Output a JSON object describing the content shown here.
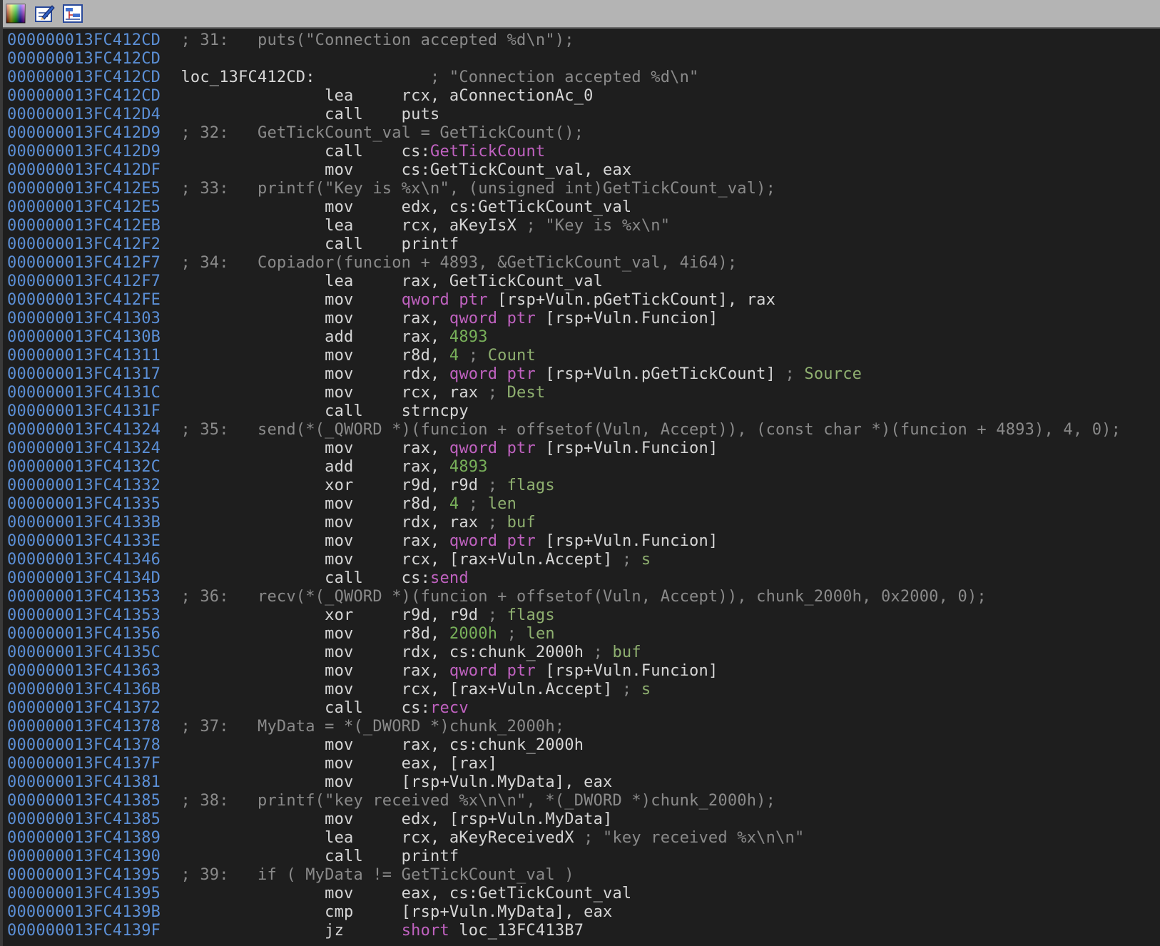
{
  "toolbar": {
    "buttons": [
      {
        "name": "color-palette-icon"
      },
      {
        "name": "edit-pencil-icon"
      },
      {
        "name": "graph-view-icon"
      }
    ]
  },
  "colors": {
    "address": "#5b8fd6",
    "text": "#d6d6d6",
    "comment": "#8a8a8a",
    "number": "#78b05a",
    "keyword": "#c062c0",
    "background": "#1e1e1e"
  },
  "lines": [
    {
      "addr": "000000013FC412CD",
      "parts": [
        {
          "t": " ; 31:   puts(\"Connection accepted %d\\n\");",
          "c": "comment"
        }
      ]
    },
    {
      "addr": "000000013FC412CD",
      "parts": []
    },
    {
      "addr": "000000013FC412CD",
      "parts": [
        {
          "t": " loc_13FC412CD:",
          "c": "default"
        },
        {
          "t": "            ; \"Connection accepted %d\\n\"",
          "c": "comment"
        }
      ]
    },
    {
      "addr": "000000013FC412CD",
      "parts": [
        {
          "t": "                lea     rcx, aConnectionAc_0",
          "c": "default"
        }
      ]
    },
    {
      "addr": "000000013FC412D4",
      "parts": [
        {
          "t": "                call    puts",
          "c": "default"
        }
      ]
    },
    {
      "addr": "000000013FC412D9",
      "parts": [
        {
          "t": " ; 32:   GetTickCount_val = GetTickCount();",
          "c": "comment"
        }
      ]
    },
    {
      "addr": "000000013FC412D9",
      "parts": [
        {
          "t": "                call    cs:",
          "c": "default"
        },
        {
          "t": "GetTickCount",
          "c": "kw"
        }
      ]
    },
    {
      "addr": "000000013FC412DF",
      "parts": [
        {
          "t": "                mov     cs:GetTickCount_val, eax",
          "c": "default"
        }
      ]
    },
    {
      "addr": "000000013FC412E5",
      "parts": [
        {
          "t": " ; 33:   printf(\"Key is %x\\n\", (unsigned int)GetTickCount_val);",
          "c": "comment"
        }
      ]
    },
    {
      "addr": "000000013FC412E5",
      "parts": [
        {
          "t": "                mov     edx, cs:GetTickCount_val",
          "c": "default"
        }
      ]
    },
    {
      "addr": "000000013FC412EB",
      "parts": [
        {
          "t": "                lea     rcx, aKeyIsX",
          "c": "default"
        },
        {
          "t": " ; \"Key is %x\\n\"",
          "c": "comment"
        }
      ]
    },
    {
      "addr": "000000013FC412F2",
      "parts": [
        {
          "t": "                call    printf",
          "c": "default"
        }
      ]
    },
    {
      "addr": "000000013FC412F7",
      "parts": [
        {
          "t": " ; 34:   Copiador(funcion + 4893, &GetTickCount_val, 4i64);",
          "c": "comment"
        }
      ]
    },
    {
      "addr": "000000013FC412F7",
      "parts": [
        {
          "t": "                lea     rax, GetTickCount_val",
          "c": "default"
        }
      ]
    },
    {
      "addr": "000000013FC412FE",
      "parts": [
        {
          "t": "                mov     ",
          "c": "default"
        },
        {
          "t": "qword ptr",
          "c": "kw"
        },
        {
          "t": " [rsp+Vuln.pGetTickCount], rax",
          "c": "default"
        }
      ]
    },
    {
      "addr": "000000013FC41303",
      "parts": [
        {
          "t": "                mov     rax, ",
          "c": "default"
        },
        {
          "t": "qword ptr",
          "c": "kw"
        },
        {
          "t": " [rsp+Vuln.Funcion]",
          "c": "default"
        }
      ]
    },
    {
      "addr": "000000013FC4130B",
      "parts": [
        {
          "t": "                add     rax, ",
          "c": "default"
        },
        {
          "t": "4893",
          "c": "num"
        }
      ]
    },
    {
      "addr": "000000013FC41311",
      "parts": [
        {
          "t": "                mov     r8d, ",
          "c": "default"
        },
        {
          "t": "4",
          "c": "num"
        },
        {
          "t": " ; ",
          "c": "comment"
        },
        {
          "t": "Count",
          "c": "green"
        }
      ]
    },
    {
      "addr": "000000013FC41317",
      "parts": [
        {
          "t": "                mov     rdx, ",
          "c": "default"
        },
        {
          "t": "qword ptr",
          "c": "kw"
        },
        {
          "t": " [rsp+Vuln.pGetTickCount]",
          "c": "default"
        },
        {
          "t": " ; ",
          "c": "comment"
        },
        {
          "t": "Source",
          "c": "green"
        }
      ]
    },
    {
      "addr": "000000013FC4131C",
      "parts": [
        {
          "t": "                mov     rcx, rax",
          "c": "default"
        },
        {
          "t": " ; ",
          "c": "comment"
        },
        {
          "t": "Dest",
          "c": "green"
        }
      ]
    },
    {
      "addr": "000000013FC4131F",
      "parts": [
        {
          "t": "                call    strncpy",
          "c": "default"
        }
      ]
    },
    {
      "addr": "000000013FC41324",
      "parts": [
        {
          "t": " ; 35:   send(*(_QWORD *)(funcion + offsetof(Vuln, Accept)), (const char *)(funcion + 4893), 4, 0);",
          "c": "comment"
        }
      ]
    },
    {
      "addr": "000000013FC41324",
      "parts": [
        {
          "t": "                mov     rax, ",
          "c": "default"
        },
        {
          "t": "qword ptr",
          "c": "kw"
        },
        {
          "t": " [rsp+Vuln.Funcion]",
          "c": "default"
        }
      ]
    },
    {
      "addr": "000000013FC4132C",
      "parts": [
        {
          "t": "                add     rax, ",
          "c": "default"
        },
        {
          "t": "4893",
          "c": "num"
        }
      ]
    },
    {
      "addr": "000000013FC41332",
      "parts": [
        {
          "t": "                xor     r9d, r9d",
          "c": "default"
        },
        {
          "t": " ; ",
          "c": "comment"
        },
        {
          "t": "flags",
          "c": "green"
        }
      ]
    },
    {
      "addr": "000000013FC41335",
      "parts": [
        {
          "t": "                mov     r8d, ",
          "c": "default"
        },
        {
          "t": "4",
          "c": "num"
        },
        {
          "t": " ; ",
          "c": "comment"
        },
        {
          "t": "len",
          "c": "green"
        }
      ]
    },
    {
      "addr": "000000013FC4133B",
      "parts": [
        {
          "t": "                mov     rdx, rax",
          "c": "default"
        },
        {
          "t": " ; ",
          "c": "comment"
        },
        {
          "t": "buf",
          "c": "green"
        }
      ]
    },
    {
      "addr": "000000013FC4133E",
      "parts": [
        {
          "t": "                mov     rax, ",
          "c": "default"
        },
        {
          "t": "qword ptr",
          "c": "kw"
        },
        {
          "t": " [rsp+Vuln.Funcion]",
          "c": "default"
        }
      ]
    },
    {
      "addr": "000000013FC41346",
      "parts": [
        {
          "t": "                mov     rcx, [rax+Vuln.Accept]",
          "c": "default"
        },
        {
          "t": " ; ",
          "c": "comment"
        },
        {
          "t": "s",
          "c": "green"
        }
      ]
    },
    {
      "addr": "000000013FC4134D",
      "parts": [
        {
          "t": "                call    cs:",
          "c": "default"
        },
        {
          "t": "send",
          "c": "kw"
        }
      ]
    },
    {
      "addr": "000000013FC41353",
      "parts": [
        {
          "t": " ; 36:   recv(*(_QWORD *)(funcion + offsetof(Vuln, Accept)), chunk_2000h, 0x2000, 0);",
          "c": "comment"
        }
      ]
    },
    {
      "addr": "000000013FC41353",
      "parts": [
        {
          "t": "                xor     r9d, r9d",
          "c": "default"
        },
        {
          "t": " ; ",
          "c": "comment"
        },
        {
          "t": "flags",
          "c": "green"
        }
      ]
    },
    {
      "addr": "000000013FC41356",
      "parts": [
        {
          "t": "                mov     r8d, ",
          "c": "default"
        },
        {
          "t": "2000h",
          "c": "num"
        },
        {
          "t": " ; ",
          "c": "comment"
        },
        {
          "t": "len",
          "c": "green"
        }
      ]
    },
    {
      "addr": "000000013FC4135C",
      "parts": [
        {
          "t": "                mov     rdx, cs:chunk_2000h",
          "c": "default"
        },
        {
          "t": " ; ",
          "c": "comment"
        },
        {
          "t": "buf",
          "c": "green"
        }
      ]
    },
    {
      "addr": "000000013FC41363",
      "parts": [
        {
          "t": "                mov     rax, ",
          "c": "default"
        },
        {
          "t": "qword ptr",
          "c": "kw"
        },
        {
          "t": " [rsp+Vuln.Funcion]",
          "c": "default"
        }
      ]
    },
    {
      "addr": "000000013FC4136B",
      "parts": [
        {
          "t": "                mov     rcx, [rax+Vuln.Accept]",
          "c": "default"
        },
        {
          "t": " ; ",
          "c": "comment"
        },
        {
          "t": "s",
          "c": "green"
        }
      ]
    },
    {
      "addr": "000000013FC41372",
      "parts": [
        {
          "t": "                call    cs:",
          "c": "default"
        },
        {
          "t": "recv",
          "c": "kw"
        }
      ]
    },
    {
      "addr": "000000013FC41378",
      "parts": [
        {
          "t": " ; 37:   MyData = *(_DWORD *)chunk_2000h;",
          "c": "comment"
        }
      ]
    },
    {
      "addr": "000000013FC41378",
      "parts": [
        {
          "t": "                mov     rax, cs:chunk_2000h",
          "c": "default"
        }
      ]
    },
    {
      "addr": "000000013FC4137F",
      "parts": [
        {
          "t": "                mov     eax, [rax]",
          "c": "default"
        }
      ]
    },
    {
      "addr": "000000013FC41381",
      "parts": [
        {
          "t": "                mov     [rsp+Vuln.MyData], eax",
          "c": "default"
        }
      ]
    },
    {
      "addr": "000000013FC41385",
      "parts": [
        {
          "t": " ; 38:   printf(\"key received %x\\n\\n\", *(_DWORD *)chunk_2000h);",
          "c": "comment"
        }
      ]
    },
    {
      "addr": "000000013FC41385",
      "parts": [
        {
          "t": "                mov     edx, [rsp+Vuln.MyData]",
          "c": "default"
        }
      ]
    },
    {
      "addr": "000000013FC41389",
      "parts": [
        {
          "t": "                lea     rcx, aKeyReceivedX",
          "c": "default"
        },
        {
          "t": " ; \"key received %x\\n\\n\"",
          "c": "comment"
        }
      ]
    },
    {
      "addr": "000000013FC41390",
      "parts": [
        {
          "t": "                call    printf",
          "c": "default"
        }
      ]
    },
    {
      "addr": "000000013FC41395",
      "parts": [
        {
          "t": " ; 39:   if ( MyData != GetTickCount_val )",
          "c": "comment"
        }
      ]
    },
    {
      "addr": "000000013FC41395",
      "parts": [
        {
          "t": "                mov     eax, cs:GetTickCount_val",
          "c": "default"
        }
      ]
    },
    {
      "addr": "000000013FC4139B",
      "parts": [
        {
          "t": "                cmp     [rsp+Vuln.MyData], eax",
          "c": "default"
        }
      ]
    },
    {
      "addr": "000000013FC4139F",
      "parts": [
        {
          "t": "                jz      ",
          "c": "default"
        },
        {
          "t": "short",
          "c": "kw"
        },
        {
          "t": " loc_13FC413B7",
          "c": "default"
        }
      ]
    }
  ]
}
